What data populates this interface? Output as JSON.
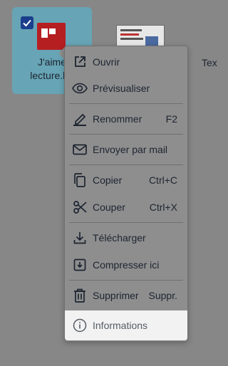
{
  "files": [
    {
      "name": "J'aime\nlecture.bo",
      "selected": true
    },
    {
      "name": "",
      "selected": false
    },
    {
      "name": "Tex",
      "selected": false
    }
  ],
  "menu": {
    "items": [
      {
        "label": "Ouvrir",
        "shortcut": "",
        "icon": "open-external-icon"
      },
      {
        "label": "Prévisualiser",
        "shortcut": "",
        "icon": "eye-icon"
      },
      {
        "label": "Renommer",
        "shortcut": "F2",
        "icon": "pen-icon"
      },
      {
        "label": "Envoyer par mail",
        "shortcut": "",
        "icon": "mail-icon"
      },
      {
        "label": "Copier",
        "shortcut": "Ctrl+C",
        "icon": "copy-icon"
      },
      {
        "label": "Couper",
        "shortcut": "Ctrl+X",
        "icon": "scissors-icon"
      },
      {
        "label": "Télécharger",
        "shortcut": "",
        "icon": "download-icon"
      },
      {
        "label": "Compresser ici",
        "shortcut": "",
        "icon": "archive-icon"
      },
      {
        "label": "Supprimer",
        "shortcut": "Suppr.",
        "icon": "trash-icon"
      },
      {
        "label": "Informations",
        "shortcut": "",
        "icon": "info-icon"
      }
    ]
  },
  "colors": {
    "accent": "#1a3e8c",
    "selection": "#67a4b5",
    "menu_bg": "#8e8e8e",
    "hover_bg": "#f2f2f2"
  }
}
